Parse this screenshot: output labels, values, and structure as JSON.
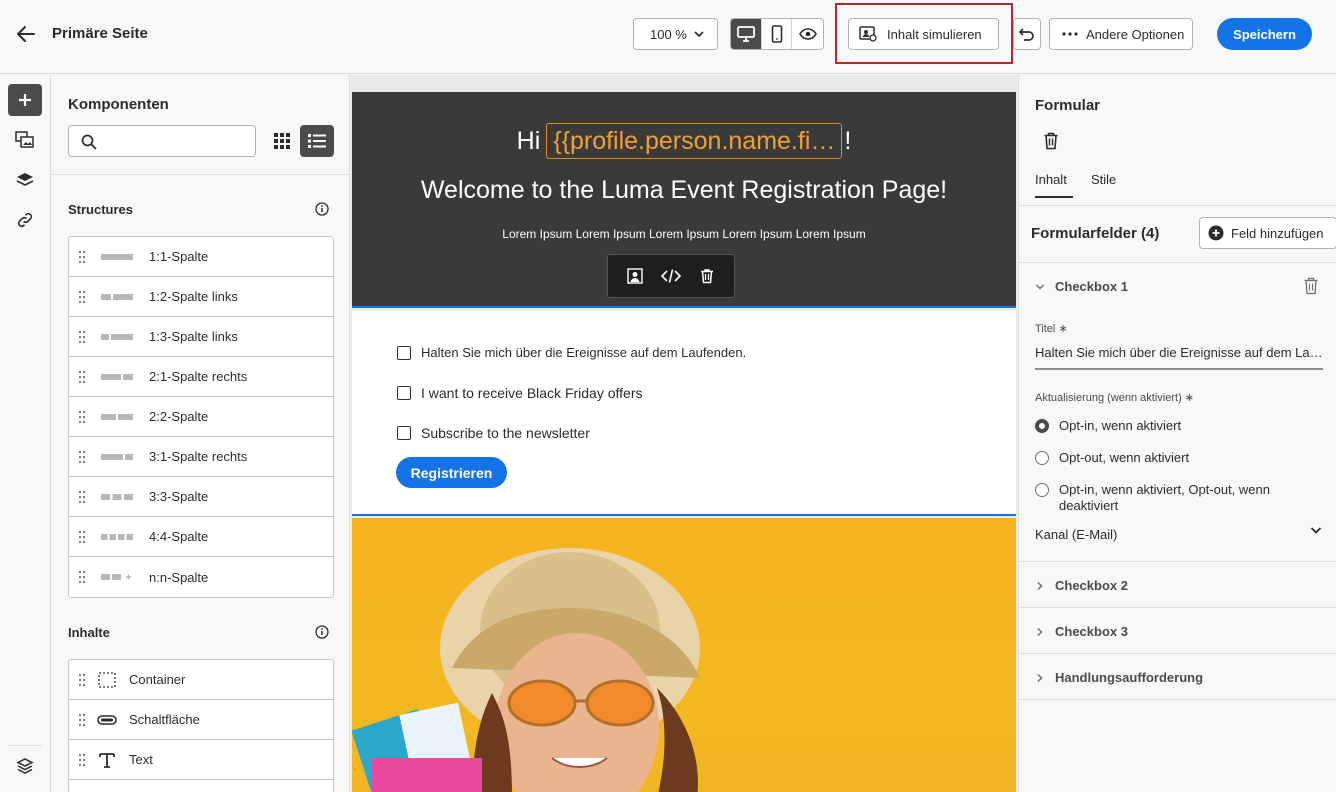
{
  "header": {
    "page_title": "Primäre Seite",
    "zoom": "100 %",
    "simulate_label": "Inhalt simulieren",
    "more_label": "Andere Optionen",
    "save_label": "Speichern"
  },
  "components": {
    "title": "Komponenten",
    "search_placeholder": "",
    "structures_heading": "Structures",
    "structures": [
      {
        "label": "1:1-Spalte"
      },
      {
        "label": "1:2-Spalte links"
      },
      {
        "label": "1:3-Spalte links"
      },
      {
        "label": "2:1-Spalte rechts"
      },
      {
        "label": "2:2-Spalte"
      },
      {
        "label": "3:1-Spalte rechts"
      },
      {
        "label": "3:3-Spalte"
      },
      {
        "label": "4:4-Spalte"
      },
      {
        "label": "n:n-Spalte"
      }
    ],
    "contents_heading": "Inhalte",
    "contents": [
      {
        "label": "Container",
        "icon": "container-icon"
      },
      {
        "label": "Schaltfläche",
        "icon": "button-icon"
      },
      {
        "label": "Text",
        "icon": "text-icon"
      }
    ]
  },
  "canvas": {
    "hero_greeting": "Hi",
    "hero_personalization": "{{profile.person.name.fi…",
    "hero_exclaim": "!",
    "hero_title": "Welcome to the Luma Event Registration Page!",
    "hero_subtitle": "Lorem Ipsum Lorem Ipsum Lorem Ipsum Lorem Ipsum Lorem Ipsum",
    "checkboxes": [
      {
        "label": "Halten Sie mich über die Ereignisse auf dem Laufenden."
      },
      {
        "label": "I want to receive Black Friday offers"
      },
      {
        "label": "Subscribe to the newsletter"
      }
    ],
    "register_label": "Registrieren"
  },
  "right_panel": {
    "title": "Formular",
    "tabs": [
      "Inhalt",
      "Stile"
    ],
    "fields_heading": "Formularfelder (4)",
    "add_field_label": "Feld hinzufügen",
    "checkbox1_label": "Checkbox 1",
    "title_label": "Titel",
    "required_mark": "∗",
    "title_value": "Halten Sie mich über die Ereignisse auf dem Laufenden.",
    "update_label": "Aktualisierung (wenn aktiviert)",
    "radio_options": [
      {
        "label": "Opt-in, wenn aktiviert",
        "selected": true
      },
      {
        "label": "Opt-out, wenn aktiviert",
        "selected": false
      },
      {
        "label": "Opt-in, wenn aktiviert, Opt-out, wenn deaktiviert",
        "selected": false
      }
    ],
    "channel_label": "Kanal (E-Mail)",
    "collapsed": [
      "Checkbox 2",
      "Checkbox 3",
      "Handlungsaufforderung"
    ]
  },
  "colors": {
    "accent": "#1473e6",
    "highlight_border": "#b22a2a",
    "hero_bg": "#3a3a3a",
    "personalization": "#f0a030",
    "photo_bg": "#f5b320"
  }
}
